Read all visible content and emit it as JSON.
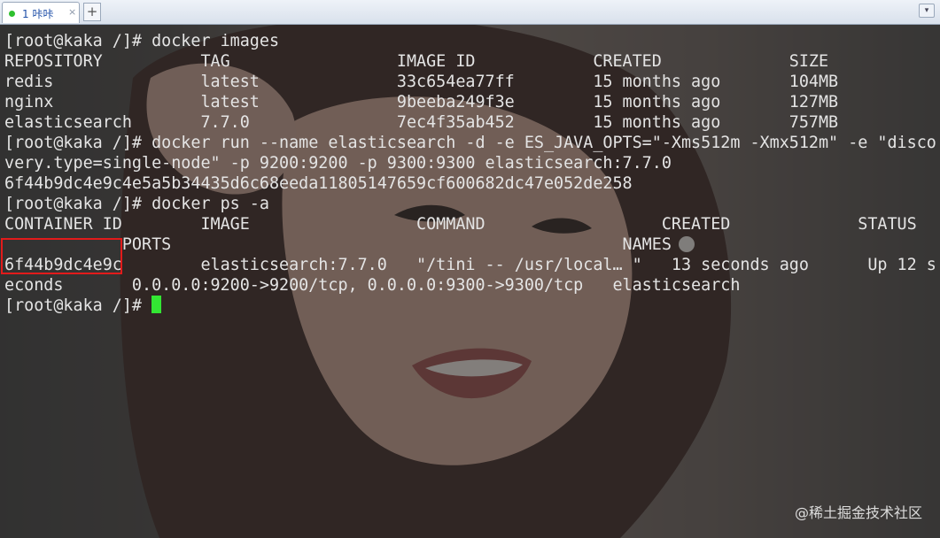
{
  "tab": {
    "label": "1 咔咔",
    "close": "×"
  },
  "tabbar": {
    "add": "+",
    "menu": "▾"
  },
  "terminal": {
    "lines": [
      "[root@kaka /]# docker images",
      "REPOSITORY          TAG                 IMAGE ID            CREATED             SIZE",
      "redis               latest              33c654ea77ff        15 months ago       104MB",
      "nginx               latest              9beeba249f3e        15 months ago       127MB",
      "elasticsearch       7.7.0               7ec4f35ab452        15 months ago       757MB",
      "[root@kaka /]# docker run --name elasticsearch -d -e ES_JAVA_OPTS=\"-Xms512m -Xmx512m\" -e \"disco",
      "very.type=single-node\" -p 9200:9200 -p 9300:9300 elasticsearch:7.7.0",
      "6f44b9dc4e9c4e5a5b34435d6c68eeda11805147659cf600682dc47e052de258",
      "[root@kaka /]# docker ps -a",
      "CONTAINER ID        IMAGE                 COMMAND                  CREATED             STATUS",
      "            PORTS                                              NAMES",
      "6f44b9dc4e9c        elasticsearch:7.7.0   \"/tini -- /usr/local… \"   13 seconds ago      Up 12 s",
      "econds       0.0.0.0:9200->9200/tcp, 0.0.0.0:9300->9300/tcp   elasticsearch",
      "[root@kaka /]# "
    ]
  },
  "watermark": "@稀土掘金技术社区",
  "colors": {
    "cursor": "#33e633",
    "highlight_box": "#e21b1b",
    "prompt_text": "#e4e4e4"
  }
}
